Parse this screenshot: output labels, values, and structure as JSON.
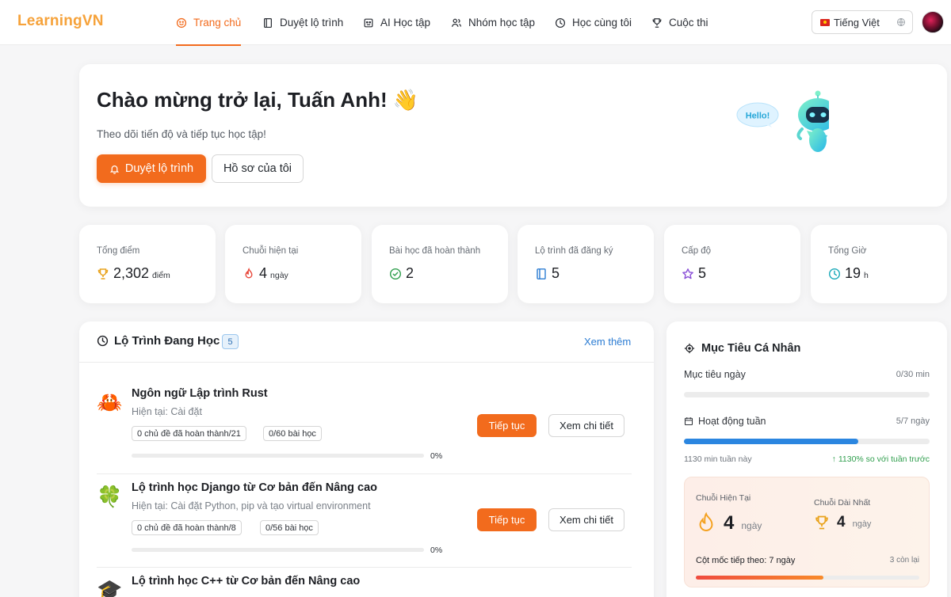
{
  "brand": "LearningVN",
  "nav": [
    {
      "label": "Trang chủ",
      "icon": "home-icon",
      "active": true
    },
    {
      "label": "Duyệt lộ trình",
      "icon": "book-icon",
      "active": false
    },
    {
      "label": "AI Học tập",
      "icon": "robot-icon",
      "active": false
    },
    {
      "label": "Nhóm học tập",
      "icon": "users-icon",
      "active": false
    },
    {
      "label": "Học cùng tôi",
      "icon": "clock-icon",
      "active": false
    },
    {
      "label": "Cuộc thi",
      "icon": "trophy-icon",
      "active": false
    }
  ],
  "language": {
    "label": "Tiếng Việt"
  },
  "welcome": {
    "title": "Chào mừng trở lại, Tuấn Anh! 👋",
    "subtitle": "Theo dõi tiến độ và tiếp tục học tập!",
    "primary_button": "Duyệt lộ trình",
    "secondary_button": "Hồ sơ của tôi",
    "robot_text": "Hello!"
  },
  "stats": [
    {
      "label": "Tổng điểm",
      "value": "2,302",
      "unit": "điểm",
      "icon": "trophy-icon",
      "color": "#e9a21b"
    },
    {
      "label": "Chuỗi hiện tại",
      "value": "4",
      "unit": "ngày",
      "icon": "flame-icon",
      "color": "#e8473a"
    },
    {
      "label": "Bài học đã hoàn thành",
      "value": "2",
      "unit": "",
      "icon": "check-circle-icon",
      "color": "#2f9e4d"
    },
    {
      "label": "Lộ trình đã đăng ký",
      "value": "5",
      "unit": "",
      "icon": "book-icon",
      "color": "#2b7cd3"
    },
    {
      "label": "Cấp độ",
      "value": "5",
      "unit": "",
      "icon": "star-icon",
      "color": "#8a4fd8"
    },
    {
      "label": "Tổng Giờ",
      "value": "19",
      "unit": "h",
      "icon": "clock-icon",
      "color": "#19a8b8"
    }
  ],
  "paths": {
    "title": "Lộ Trình Đang Học",
    "count": "5",
    "see_more": "Xem thêm",
    "continue_label": "Tiếp tục",
    "detail_label": "Xem chi tiết",
    "courses": [
      {
        "emoji": "🦀",
        "title": "Ngôn ngữ Lập trình Rust",
        "current": "Hiện tại: Cài đặt",
        "topics": "0 chủ đề đã hoàn thành/21",
        "lessons": "0/60 bài học",
        "progress": "0%",
        "progress_value": 0
      },
      {
        "emoji": "🍀",
        "title": "Lộ trình học Django từ Cơ bản đến Nâng cao",
        "current": "Hiện tại: Cài đặt Python, pip và tạo virtual environment",
        "topics": "0 chủ đề đã hoàn thành/8",
        "lessons": "0/56 bài học",
        "progress": "0%",
        "progress_value": 0
      },
      {
        "emoji": "🎓",
        "title": "Lộ trình học C++ từ Cơ bản đến Nâng cao",
        "current": "",
        "topics": "",
        "lessons": "",
        "progress": "",
        "progress_value": 0
      }
    ]
  },
  "goals": {
    "title": "Mục Tiêu Cá Nhân",
    "daily_label": "Mục tiêu ngày",
    "daily_value": "0/30 min",
    "daily_progress": 0,
    "weekly_label": "Hoạt động tuần",
    "weekly_value": "5/7 ngày",
    "weekly_progress": 0.71,
    "week_minutes": "1130 min tuần này",
    "week_change": "↑ 1130% so với tuần trước",
    "current_streak_label": "Chuỗi Hiện Tại",
    "current_streak_value": "4",
    "longest_streak_label": "Chuỗi Dài Nhất",
    "longest_streak_value": "4",
    "streak_unit": "ngày",
    "milestone_label": "Cột mốc tiếp theo: 7 ngày",
    "milestone_remaining": "3 còn lại",
    "milestone_progress": 0.57
  },
  "colors": {
    "accent": "#f26b1d",
    "brand": "#f6a23a",
    "link": "#2b7cd3",
    "weekly_bar": "#2b86e0"
  }
}
